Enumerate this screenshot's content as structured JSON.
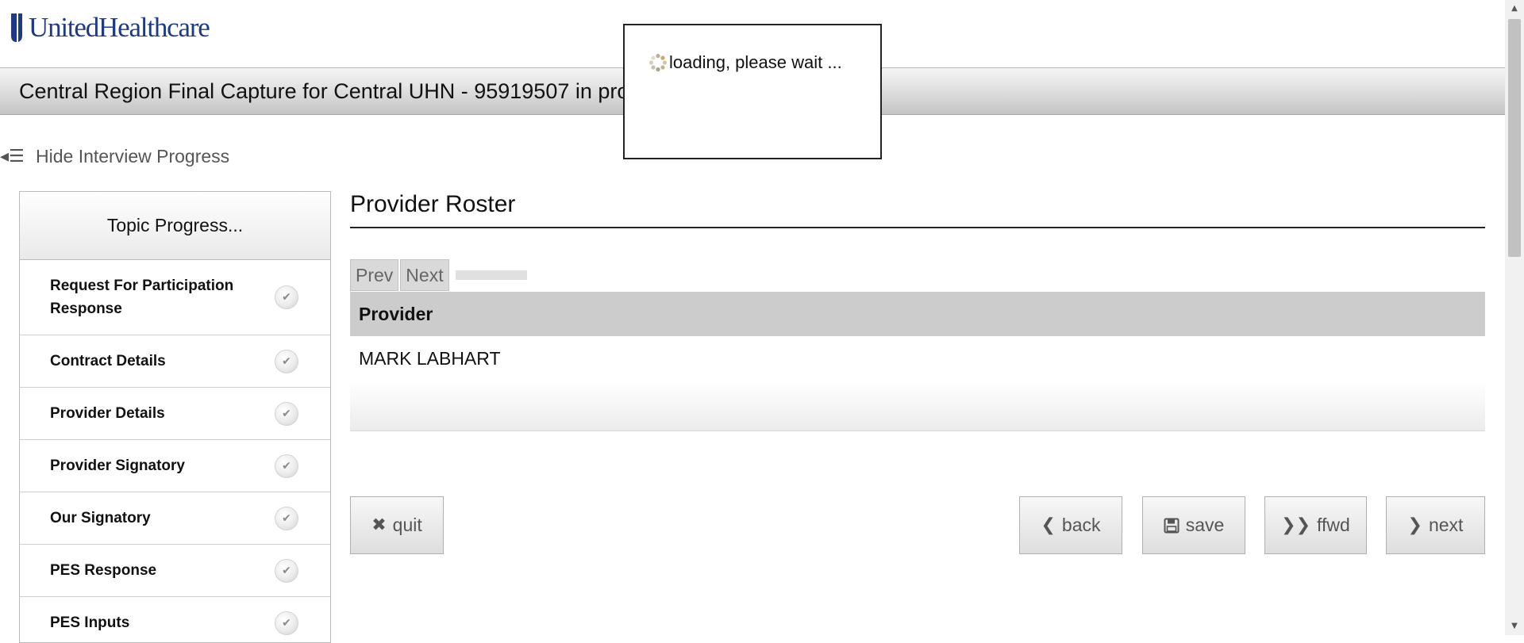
{
  "brand": {
    "name": "UnitedHealthcare",
    "color": "#1f3a84"
  },
  "title_bar": {
    "title": "Central Region Final Capture for Central UHN - 95919507 in progress"
  },
  "loading": {
    "text": "loading, please wait ...",
    "icon": "spinner-icon"
  },
  "progress_toggle": {
    "label": "Hide Interview Progress",
    "icon": "collapse-list-icon"
  },
  "topic_progress": {
    "header": "Topic Progress...",
    "items": [
      {
        "label": "Request For Participation Response",
        "status_icon": "check-icon"
      },
      {
        "label": "Contract Details",
        "status_icon": "check-icon"
      },
      {
        "label": "Provider Details",
        "status_icon": "check-icon"
      },
      {
        "label": "Provider Signatory",
        "status_icon": "check-icon"
      },
      {
        "label": "Our Signatory",
        "status_icon": "check-icon"
      },
      {
        "label": "PES Response",
        "status_icon": "check-icon"
      },
      {
        "label": "PES Inputs",
        "status_icon": "check-icon"
      }
    ]
  },
  "section": {
    "title": "Provider Roster",
    "pager": {
      "prev": "Prev",
      "next": "Next"
    },
    "table": {
      "columns": [
        "Provider"
      ],
      "rows": [
        [
          "MARK LABHART"
        ]
      ]
    }
  },
  "actions": {
    "quit": {
      "label": "quit",
      "icon": "x-icon"
    },
    "back": {
      "label": "back",
      "icon": "chevron-left-icon"
    },
    "save": {
      "label": "save",
      "icon": "floppy-disk-icon"
    },
    "ffwd": {
      "label": "ffwd",
      "icon": "double-chevron-right-icon"
    },
    "next": {
      "label": "next",
      "icon": "chevron-right-icon"
    }
  }
}
